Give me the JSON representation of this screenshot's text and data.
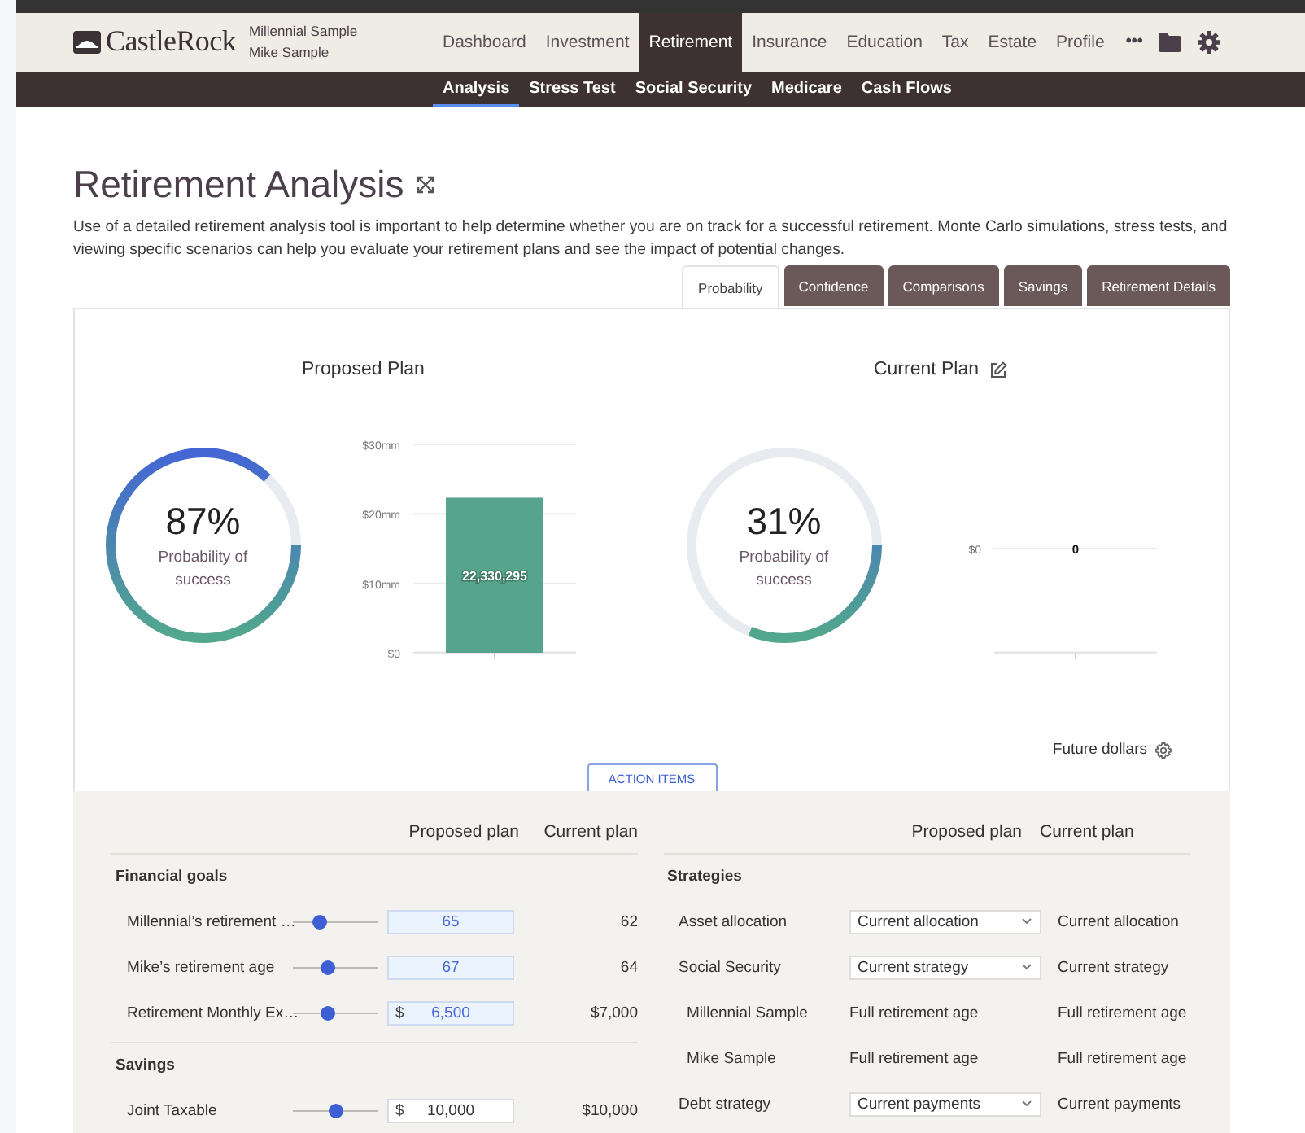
{
  "header": {
    "logo": "CastleRock",
    "users": [
      "Millennial Sample",
      "Mike Sample"
    ],
    "more": "•••",
    "nav": [
      {
        "label": "Dashboard",
        "selected": false
      },
      {
        "label": "Investment",
        "selected": false
      },
      {
        "label": "Retirement",
        "selected": true
      },
      {
        "label": "Insurance",
        "selected": false
      },
      {
        "label": "Education",
        "selected": false
      },
      {
        "label": "Tax",
        "selected": false
      },
      {
        "label": "Estate",
        "selected": false
      },
      {
        "label": "Profile",
        "selected": false
      }
    ]
  },
  "subnav": [
    {
      "label": "Analysis",
      "selected": true
    },
    {
      "label": "Stress Test",
      "selected": false
    },
    {
      "label": "Social Security",
      "selected": false
    },
    {
      "label": "Medicare",
      "selected": false
    },
    {
      "label": "Cash Flows",
      "selected": false
    }
  ],
  "page": {
    "title": "Retirement Analysis",
    "description": "Use of a detailed retirement analysis tool is important to help determine whether you are on track for a successful retirement. Monte Carlo simulations, stress tests, and viewing specific scenarios can help you evaluate your retirement plans and see the impact of potential changes."
  },
  "tabs": [
    {
      "label": "Probability",
      "selected": true
    },
    {
      "label": "Confidence",
      "selected": false
    },
    {
      "label": "Comparisons",
      "selected": false
    },
    {
      "label": "Savings",
      "selected": false
    },
    {
      "label": "Retirement Details",
      "selected": false
    }
  ],
  "plans": [
    {
      "title": "Proposed Plan",
      "editable": false,
      "gauge": {
        "value": "87%",
        "caption": "Probability of success",
        "level": 0.87
      },
      "bar_label": "22,330,295",
      "chart_data": {
        "type": "bar",
        "values": [
          22.33
        ],
        "ylim": [
          0,
          30
        ],
        "yticks": [
          {
            "value": 0,
            "label": "$0"
          },
          {
            "value": 10,
            "label": "$10mm"
          },
          {
            "value": 20,
            "label": "$20mm"
          },
          {
            "value": 30,
            "label": "$30mm"
          }
        ]
      }
    },
    {
      "title": "Current Plan",
      "editable": true,
      "gauge": {
        "value": "31%",
        "caption": "Probability of success",
        "level": 0.31
      },
      "chart": {
        "axis_label": "$0",
        "value_label": "0"
      }
    }
  ],
  "display_setting": "Future dollars",
  "action_button": "ACTION ITEMS",
  "goals_table": {
    "columns": [
      "Proposed plan",
      "Current plan"
    ],
    "sections": [
      {
        "title": "Financial goals",
        "rows": [
          {
            "label": "Millennial’s retirement …",
            "level": 0.3,
            "value": "65",
            "current": "62",
            "changed": true
          },
          {
            "label": "Mike’s retirement age",
            "level": 0.4,
            "value": "67",
            "current": "64",
            "changed": true
          },
          {
            "label": "Retirement Monthly Ex…",
            "level": 0.4,
            "prefix": "$",
            "value": "6,500",
            "current": "$7,000",
            "changed": true
          }
        ]
      },
      {
        "title": "Savings",
        "rows": [
          {
            "label": "Joint Taxable",
            "level": 0.5,
            "prefix": "$",
            "value": "10,000",
            "current": "$10,000",
            "changed": false
          }
        ]
      }
    ]
  },
  "strategies_table": {
    "columns": [
      "Proposed plan",
      "Current plan"
    ],
    "sections": [
      {
        "title": "Strategies",
        "rows": [
          {
            "label": "Asset allocation",
            "kind": "select",
            "proposed": "Current allocation",
            "current": "Current allocation"
          },
          {
            "label": "Social Security",
            "kind": "select",
            "proposed": "Current strategy",
            "current": "Current strategy",
            "children": [
              {
                "label": "Millennial Sample",
                "kind": "text",
                "proposed": "Full retirement age",
                "current": "Full retirement age"
              },
              {
                "label": "Mike Sample",
                "kind": "text",
                "proposed": "Full retirement age",
                "current": "Full retirement age"
              }
            ]
          },
          {
            "label": "Debt strategy",
            "kind": "select",
            "proposed": "Current payments",
            "current": "Current payments"
          }
        ]
      }
    ]
  }
}
